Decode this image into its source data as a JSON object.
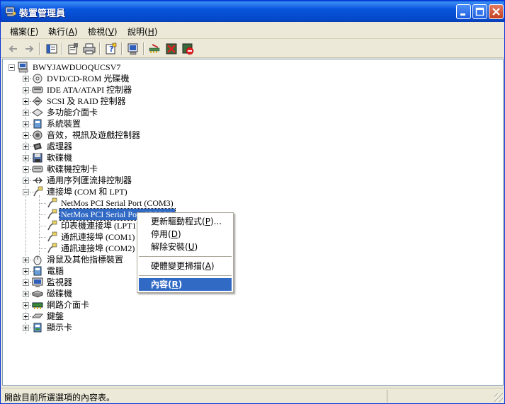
{
  "window": {
    "title": "裝置管理員",
    "icon": "device-manager-icon"
  },
  "menubar": {
    "items": [
      {
        "label": "檔案(",
        "key": "F",
        "suffix": ")"
      },
      {
        "label": "執行(",
        "key": "A",
        "suffix": ")"
      },
      {
        "label": "檢視(",
        "key": "V",
        "suffix": ")"
      },
      {
        "label": "說明(",
        "key": "H",
        "suffix": ")"
      }
    ]
  },
  "toolbar": {
    "buttons": [
      "back-arrow-icon",
      "forward-arrow-icon",
      "show-hide-tree-icon",
      "properties-icon",
      "print-icon",
      "help-icon",
      "scan-hardware-icon",
      "update-driver-icon",
      "uninstall-icon",
      "disable-icon"
    ]
  },
  "tree": {
    "root": "BWYJAWDUOQUCSV7",
    "categories": [
      {
        "label": "DVD/CD-ROM 光碟機",
        "icon": "cdrom-icon"
      },
      {
        "label": "IDE ATA/ATAPI 控制器",
        "icon": "ide-controller-icon"
      },
      {
        "label": "SCSI 及 RAID 控制器",
        "icon": "scsi-controller-icon"
      },
      {
        "label": "多功能介面卡",
        "icon": "multifunction-icon"
      },
      {
        "label": "系統裝置",
        "icon": "system-device-icon"
      },
      {
        "label": "音效，視訊及遊戲控制器",
        "icon": "sound-icon"
      },
      {
        "label": "處理器",
        "icon": "processor-icon"
      },
      {
        "label": "軟碟機",
        "icon": "floppy-drive-icon"
      },
      {
        "label": "軟碟機控制卡",
        "icon": "floppy-controller-icon"
      },
      {
        "label": "通用序列匯流排控制器",
        "icon": "usb-icon"
      },
      {
        "label": "連接埠 (COM 和 LPT)",
        "icon": "port-icon"
      }
    ],
    "ports": [
      {
        "label": "NetMos PCI Serial Port (COM3)",
        "selected": false
      },
      {
        "label": "NetMos PCI Serial Port (COM4)",
        "selected": true
      },
      {
        "label": "印表機連接埠 (LPT1)",
        "selected": false
      },
      {
        "label": "通訊連接埠 (COM1)",
        "selected": false
      },
      {
        "label": "通訊連接埠 (COM2)",
        "selected": false
      }
    ],
    "categories_after": [
      {
        "label": "滑鼠及其他指標裝置",
        "icon": "mouse-icon"
      },
      {
        "label": "電腦",
        "icon": "computer-icon"
      },
      {
        "label": "監視器",
        "icon": "monitor-icon"
      },
      {
        "label": "磁碟機",
        "icon": "disk-drive-icon"
      },
      {
        "label": "網路介面卡",
        "icon": "network-adapter-icon"
      },
      {
        "label": "鍵盤",
        "icon": "keyboard-icon"
      },
      {
        "label": "顯示卡",
        "icon": "display-adapter-icon"
      }
    ]
  },
  "context_menu": {
    "items": [
      {
        "label": "更新驅動程式(",
        "key": "P",
        "suffix": ")..."
      },
      {
        "label": "停用(",
        "key": "D",
        "suffix": ")"
      },
      {
        "label": "解除安裝(",
        "key": "U",
        "suffix": ")"
      },
      {
        "label": "硬體變更掃描(",
        "key": "A",
        "suffix": ")"
      },
      {
        "label": "內容(",
        "key": "R",
        "suffix": ")"
      }
    ]
  },
  "statusbar": {
    "text": "開啟目前所選選項的內容表。"
  },
  "colors": {
    "title_gradient": "#0855dd",
    "selection": "#316ac5",
    "window_bg": "#ece9d8"
  }
}
